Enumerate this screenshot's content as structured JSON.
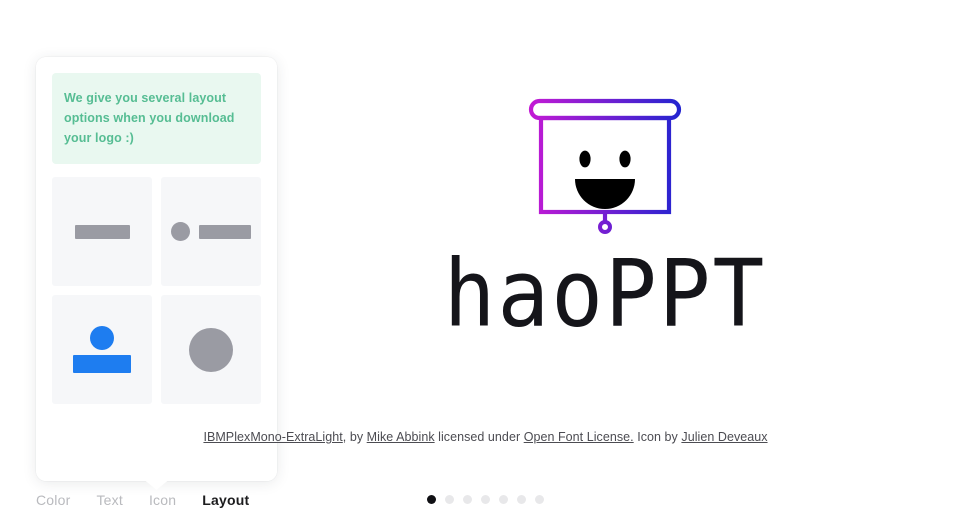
{
  "panel": {
    "tip": {
      "text": "We give you several layout options when you download your logo :)",
      "bg_color": "#e9f8f0",
      "text_color": "#56bd93"
    },
    "layout_options": [
      {
        "name": "text-only",
        "icon": "bar-shape",
        "selected": false
      },
      {
        "name": "icon-left-text",
        "icon": "dot-and-bar-shape",
        "selected": false
      },
      {
        "name": "icon-above-text",
        "icon": "dot-above-bar-shape",
        "selected": true
      },
      {
        "name": "icon-only",
        "icon": "large-circle-shape",
        "selected": false
      }
    ]
  },
  "tabs": [
    {
      "label": "Color",
      "active": false
    },
    {
      "label": "Text",
      "active": false
    },
    {
      "label": "Icon",
      "active": false
    },
    {
      "label": "Layout",
      "active": true
    }
  ],
  "logo": {
    "wordmark": "haoPPT",
    "icon_name": "projector-screen-smiling-face-icon",
    "gradient_from": "#c21ad4",
    "gradient_to": "#2424d0",
    "face_color": "#000000",
    "wordmark_color": "#15151a"
  },
  "attribution": {
    "font_link": "IBMPlexMono-ExtraLight",
    "separator_1": ", by ",
    "author_link": "Mike Abbink",
    "separator_2": " licensed under ",
    "license_link": "Open Font License.",
    "separator_3": " Icon by ",
    "icon_author_link": "Julien Deveaux"
  },
  "pager": {
    "total": 7,
    "active_index": 0,
    "dots": [
      {
        "active": true
      },
      {
        "active": false
      },
      {
        "active": false
      },
      {
        "active": false
      },
      {
        "active": false
      },
      {
        "active": false
      },
      {
        "active": false
      }
    ]
  }
}
